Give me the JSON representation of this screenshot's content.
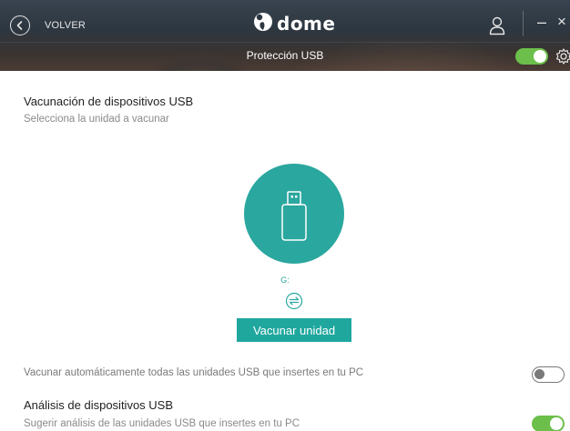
{
  "header": {
    "back_label": "VOLVER",
    "logo_text": "dome",
    "section_title": "Protección USB",
    "protection_enabled": true
  },
  "main": {
    "vaccination_title": "Vacunación de dispositivos USB",
    "vaccination_subtitle": "Selecciona la unidad a vacunar",
    "drive_letter": "G:",
    "vaccinate_button": "Vacunar unidad",
    "auto_vaccinate_label": "Vacunar automáticamente todas las unidades USB que insertes en tu PC",
    "auto_vaccinate_enabled": false,
    "analysis_title": "Análisis de dispositivos USB",
    "analysis_subtitle": "Sugerir análisis de las unidades USB que insertes en tu PC",
    "analysis_enabled": true
  },
  "colors": {
    "accent_teal": "#2aa79f",
    "toggle_green": "#6cbf4a",
    "header_dark": "#2d3741"
  },
  "icons": {
    "back": "chevron-left-circle-icon",
    "logo": "panda-logo-icon",
    "user": "user-icon",
    "minimize": "minimize-icon",
    "close": "close-icon",
    "settings": "gear-icon",
    "usb": "usb-drive-icon",
    "refresh": "refresh-arrows-icon"
  }
}
